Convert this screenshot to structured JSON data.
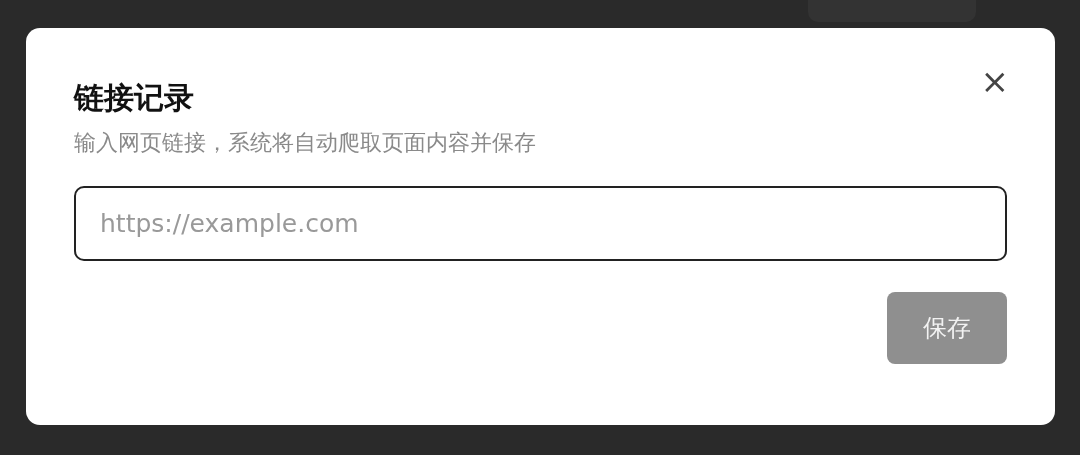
{
  "dialog": {
    "title": "链接记录",
    "close": "×",
    "description": "输入网页链接，系统将自动爬取页面内容并保存",
    "url_field": {
      "placeholder": "https://example.com"
    },
    "save_button": {
      "label": "保存",
      "disabled": true
    }
  }
}
